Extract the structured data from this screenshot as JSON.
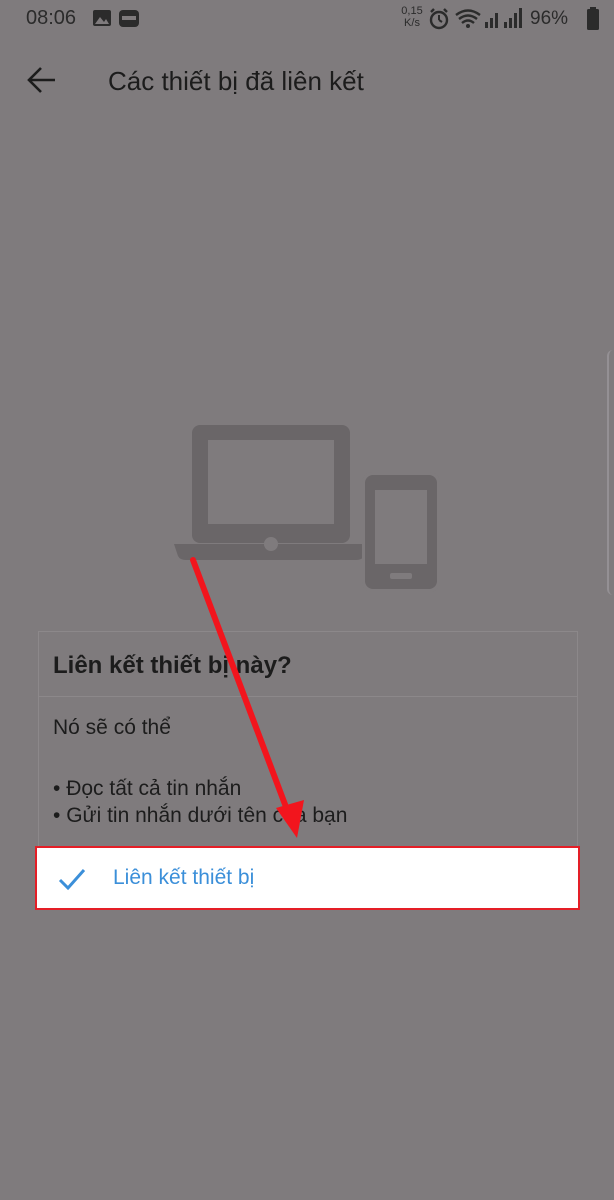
{
  "status_bar": {
    "time": "08:06",
    "network_speed_value": "0,15",
    "network_speed_unit": "K/s",
    "battery": "96%",
    "left_icons": [
      "gallery-icon",
      "zalo-notification-icon"
    ],
    "right_icons": [
      "alarm-icon",
      "wifi-icon",
      "signal-icon",
      "signal-icon",
      "battery-icon"
    ]
  },
  "header": {
    "title": "Các thiết bị đã liên kết",
    "back_icon": "arrow-left-icon"
  },
  "illustration": {
    "icons": [
      "laptop-icon",
      "phone-icon"
    ]
  },
  "dialog": {
    "title": "Liên kết thiết bị này?",
    "body": "Nó sẽ có thể",
    "permissions": [
      "Đọc tất cả tin nhắn",
      "Gửi tin nhắn dưới tên của bạn"
    ],
    "confirm_label": "Liên kết thiết bị",
    "confirm_icon": "check-icon"
  },
  "colors": {
    "overlay_background": "#7f7b7d",
    "accent": "#3b8fd9",
    "annotation_red": "#e41e26"
  }
}
